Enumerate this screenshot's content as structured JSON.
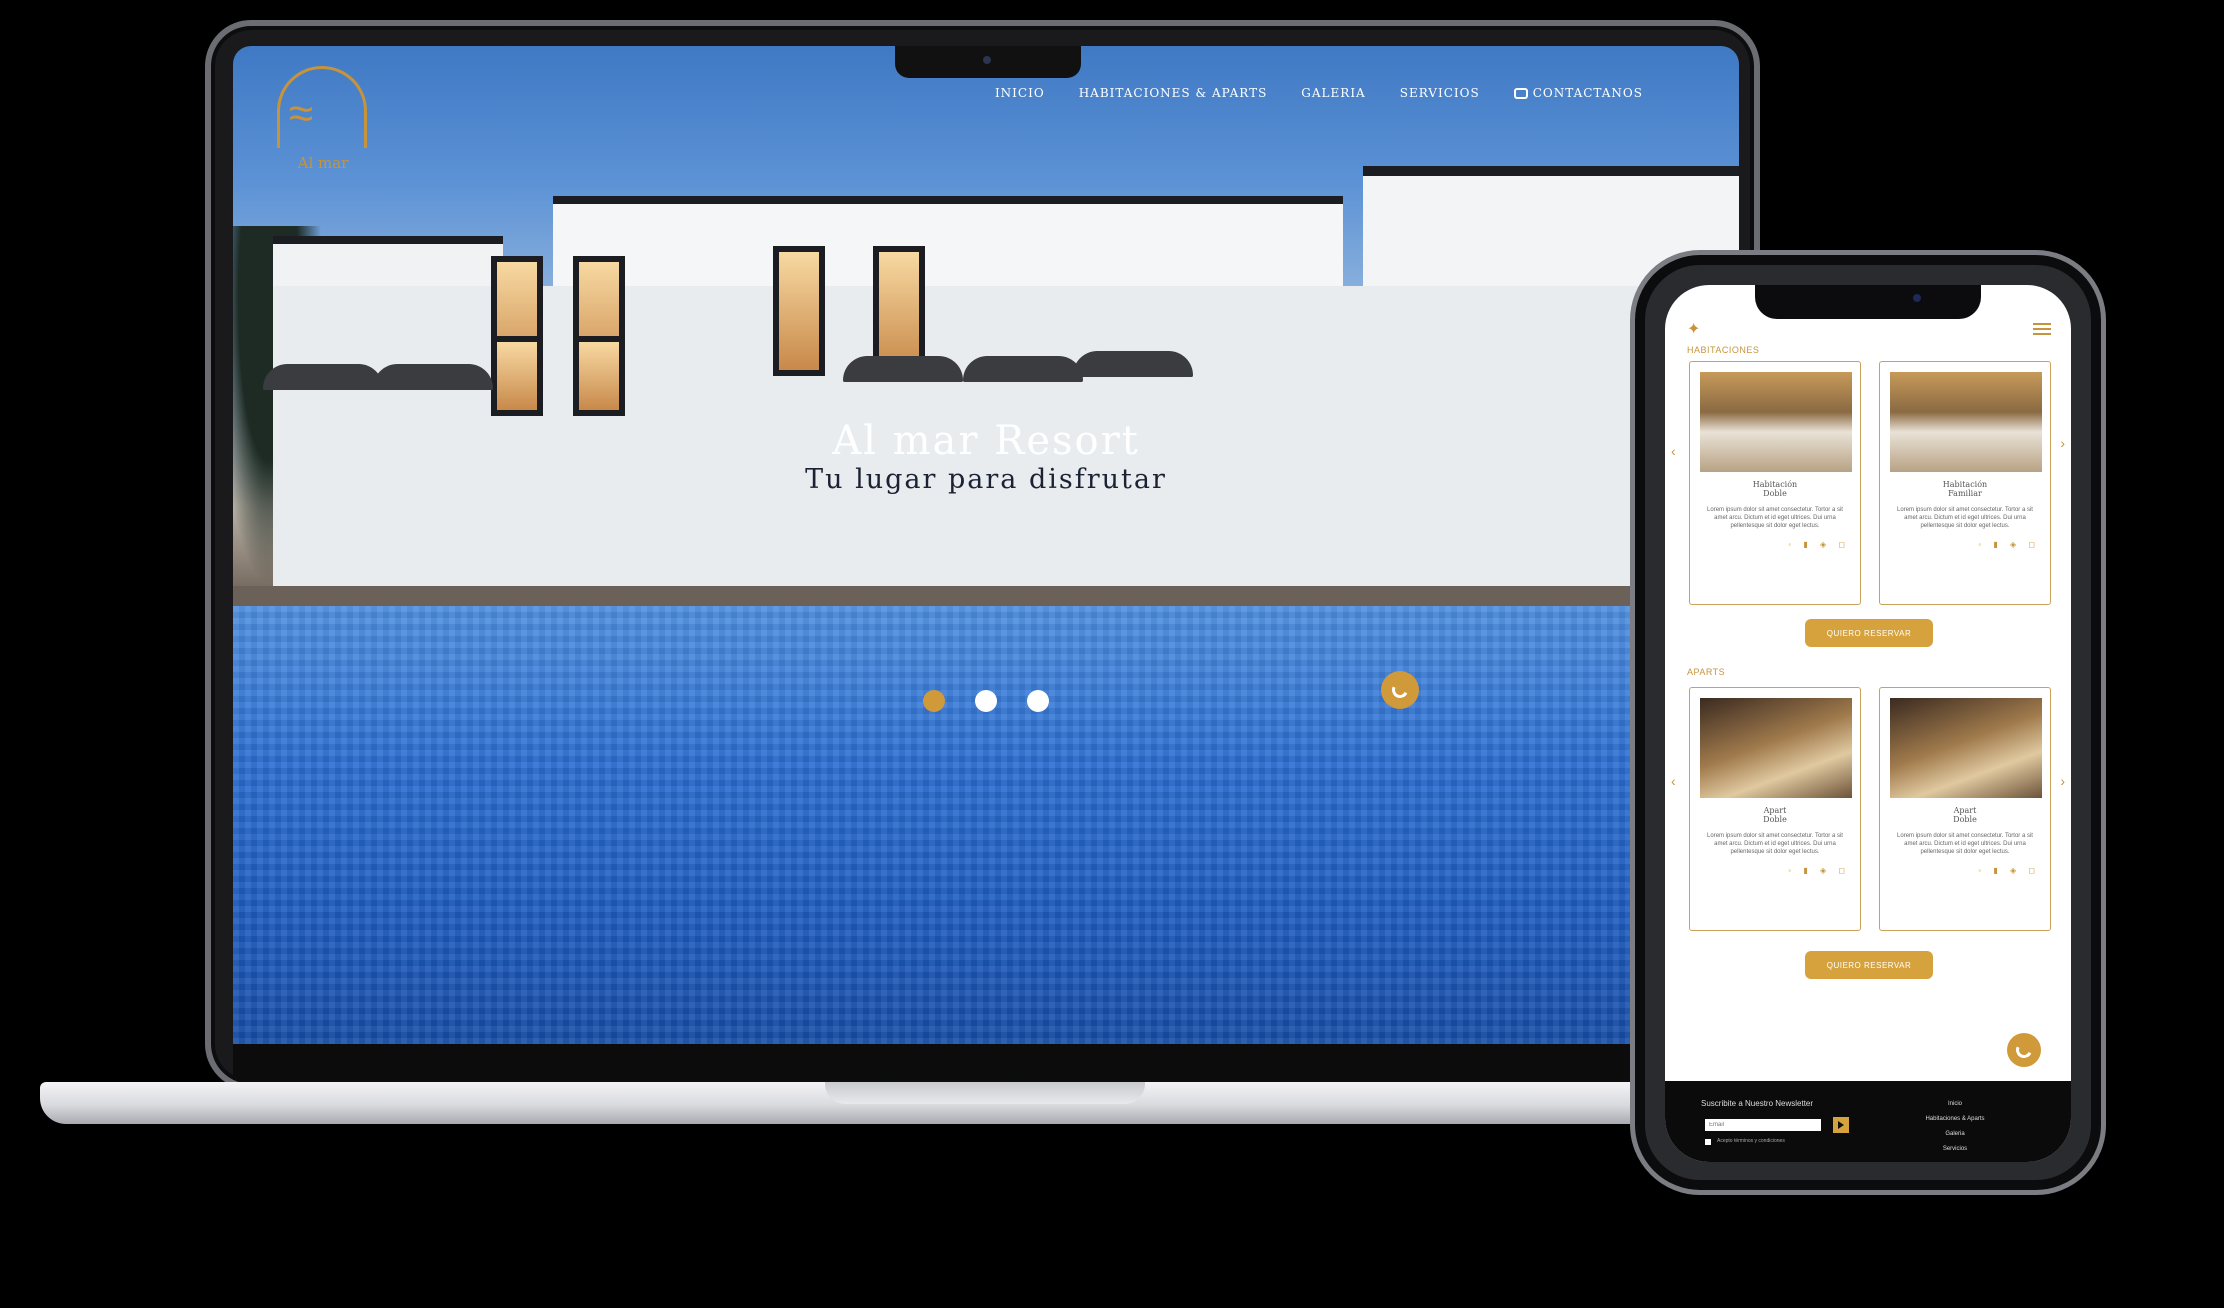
{
  "site": {
    "logo_text": "Al mar",
    "nav": [
      {
        "label": "INICIO"
      },
      {
        "label": "HABITACIONES & APARTS"
      },
      {
        "label": "GALERIA"
      },
      {
        "label": "SERVICIOS"
      },
      {
        "label": "CONTACTANOS"
      }
    ],
    "hero_title": "Al mar Resort",
    "hero_subtitle": "Tu lugar para disfrutar",
    "slider_dots": 3,
    "active_dot": 0
  },
  "mobile": {
    "section_rooms": "HABITACIONES",
    "section_aparts": "APARTS",
    "rooms": [
      {
        "title": "Habitación\nDoble",
        "text": "Lorem ipsum dolor sit amet consectetur. Tortor a sit amet arcu. Dictum et id eget ultrices. Dui urna pellentesque sit dolor eget lectus."
      },
      {
        "title": "Habitación\nFamiliar",
        "text": "Lorem ipsum dolor sit amet consectetur. Tortor a sit amet arcu. Dictum et id eget ultrices. Dui urna pellentesque sit dolor eget lectus."
      }
    ],
    "aparts": [
      {
        "title": "Apart\nDoble",
        "text": "Lorem ipsum dolor sit amet consectetur. Tortor a sit amet arcu. Dictum et id eget ultrices. Dui urna pellentesque sit dolor eget lectus."
      },
      {
        "title": "Apart\nDoble",
        "text": "Lorem ipsum dolor sit amet consectetur. Tortor a sit amet arcu. Dictum et id eget ultrices. Dui urna pellentesque sit dolor eget lectus."
      }
    ],
    "card_icons": "◦ ▮ ◈ ◻",
    "cta_label": "QUIERO RESERVAR",
    "footer": {
      "newsletter_title": "Suscribite a Nuestro Newsletter",
      "email_placeholder": "Email",
      "checkbox_label": "Acepto términos y condiciones",
      "links": [
        "Inicio",
        "Habitaciones & Aparts",
        "Galeria",
        "Servicios"
      ]
    }
  },
  "colors": {
    "accent": "#d09a3a",
    "brand_gold": "#c7943b",
    "footer_bg": "#0b0b0c"
  }
}
